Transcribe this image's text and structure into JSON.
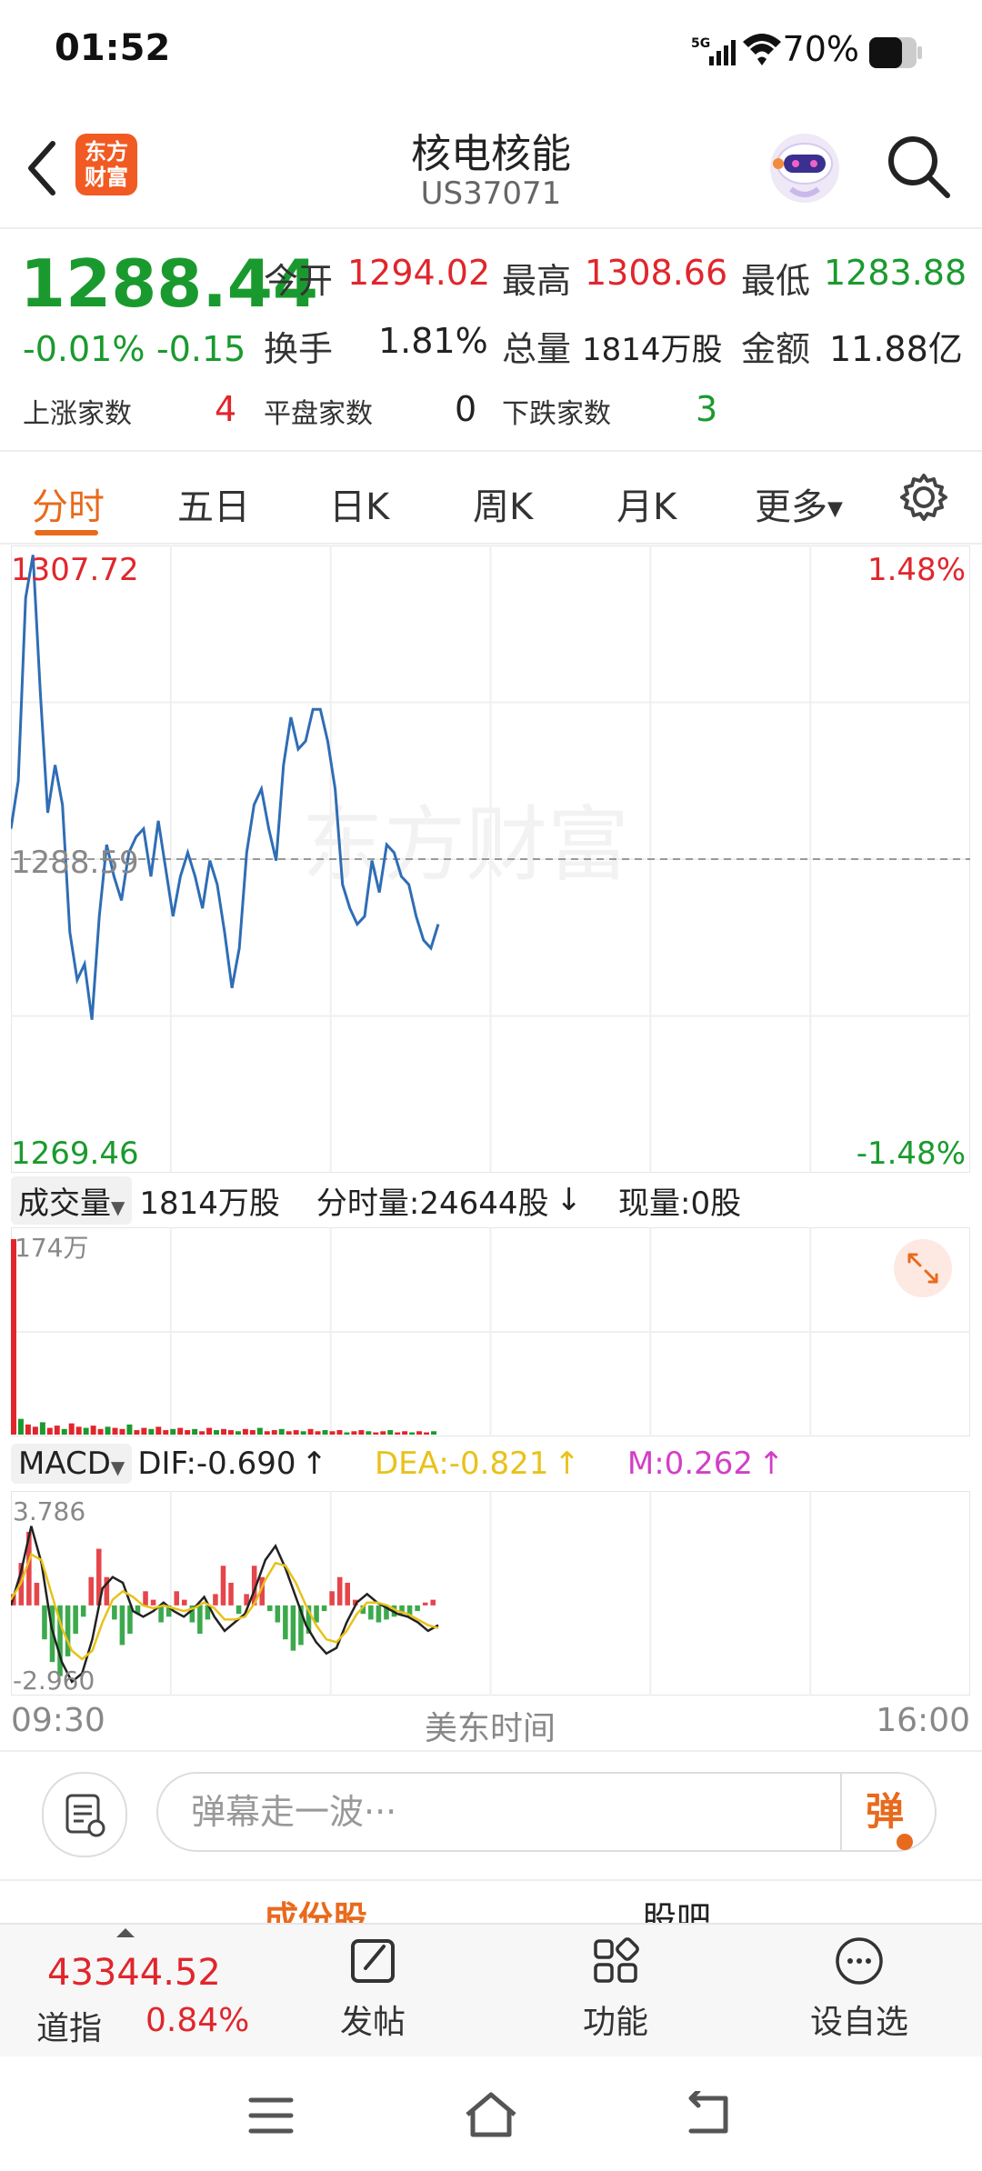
{
  "status_bar": {
    "time": "01:52",
    "network": "5G",
    "battery": "70%"
  },
  "header": {
    "title": "核电核能",
    "code": "US37071",
    "logo_text_1": "东方",
    "logo_text_2": "财富"
  },
  "quote": {
    "price": "1288.44",
    "change_pct": "-0.01%",
    "change_val": "-0.15",
    "open_label": "今开",
    "open": "1294.02",
    "high_label": "最高",
    "high": "1308.66",
    "low_label": "最低",
    "low": "1283.88",
    "turnover_label": "换手",
    "turnover": "1.81%",
    "volume_label": "总量",
    "volume": "1814万股",
    "amount_label": "金额",
    "amount": "11.88亿",
    "up_label": "上涨家数",
    "up": "4",
    "flat_label": "平盘家数",
    "flat": "0",
    "down_label": "下跌家数",
    "down": "3"
  },
  "tabs": {
    "t1": "分时",
    "t2": "五日",
    "t3": "日K",
    "t4": "周K",
    "t5": "月K",
    "t6": "更多"
  },
  "chart_data": [
    {
      "type": "line",
      "name": "intraday",
      "ymax_label": "1307.72",
      "ymin_label": "1269.46",
      "mid_label": "1288.59",
      "pct_max_label": "1.48%",
      "pct_min_label": "-1.48%",
      "ylim": [
        1269.46,
        1307.72
      ],
      "watermark": "东方财富",
      "values": [
        1290.5,
        1293.5,
        1305.0,
        1307.7,
        1299.0,
        1291.5,
        1294.5,
        1292.0,
        1284.0,
        1281.0,
        1282.0,
        1278.5,
        1285.0,
        1289.5,
        1287.5,
        1286.0,
        1289.0,
        1290.0,
        1290.5,
        1287.5,
        1291.0,
        1288.0,
        1285.0,
        1287.5,
        1289.0,
        1287.5,
        1285.5,
        1288.5,
        1287.0,
        1284.0,
        1280.5,
        1283.0,
        1289.0,
        1292.0,
        1293.0,
        1290.5,
        1288.5,
        1294.5,
        1297.5,
        1295.5,
        1296.0,
        1298.0,
        1298.0,
        1296.0,
        1293.0,
        1287.0,
        1285.5,
        1284.5,
        1285.0,
        1288.5,
        1286.5,
        1289.5,
        1289.0,
        1287.5,
        1287.0,
        1285.0,
        1283.5,
        1283.0,
        1284.5
      ]
    },
    {
      "type": "bar",
      "name": "volume",
      "max_label": "174万",
      "values": [
        174,
        14,
        9,
        7,
        11,
        6,
        8,
        5,
        10,
        7,
        6,
        8,
        5,
        7,
        6,
        5,
        9,
        4,
        6,
        5,
        7,
        4,
        5,
        6,
        4,
        5,
        3,
        6,
        4,
        5,
        4,
        3,
        5,
        4,
        6,
        3,
        4,
        5,
        3,
        4,
        3,
        5,
        3,
        4,
        3,
        4,
        2,
        3,
        4,
        3,
        2,
        3,
        4,
        2,
        3,
        2,
        3,
        2,
        3
      ]
    },
    {
      "type": "bar",
      "name": "MACD",
      "max_label": "3.786",
      "min_label": "-2.960",
      "ylim": [
        -2.96,
        3.786
      ],
      "hist": [
        0.4,
        1.5,
        2.6,
        0.8,
        -1.2,
        -2.0,
        -2.5,
        -1.8,
        -1.0,
        -0.4,
        1.0,
        2.0,
        1.0,
        -0.5,
        -1.4,
        -1.0,
        -0.3,
        0.5,
        0.2,
        -0.6,
        -0.4,
        0.5,
        0.2,
        -0.6,
        -1.0,
        -0.5,
        0.4,
        1.4,
        0.8,
        -0.3,
        0.4,
        1.4,
        1.0,
        -0.2,
        -0.6,
        -1.2,
        -1.6,
        -1.4,
        -1.0,
        -0.6,
        -0.2,
        0.5,
        1.0,
        0.8,
        0.2,
        -0.3,
        -0.5,
        -0.6,
        -0.5,
        -0.4,
        -0.3,
        -0.4,
        -0.2,
        0.1,
        0.2
      ],
      "dif": [
        0.0,
        1.2,
        2.8,
        1.5,
        -0.8,
        -2.0,
        -2.7,
        -2.4,
        -1.2,
        0.6,
        1.0,
        0.8,
        -0.2,
        -0.4,
        -0.2,
        0.1,
        -0.2,
        -0.4,
        -0.1,
        0.3,
        -0.4,
        -0.9,
        -0.6,
        -0.3,
        0.6,
        1.6,
        2.1,
        1.3,
        0.3,
        -0.7,
        -1.3,
        -1.7,
        -1.5,
        -0.6,
        0.1,
        0.4,
        0.1,
        -0.1,
        -0.3,
        -0.4,
        -0.6,
        -0.9,
        -0.7
      ],
      "dea": [
        0.2,
        0.8,
        1.8,
        1.6,
        0.4,
        -0.8,
        -1.6,
        -1.9,
        -1.6,
        -0.6,
        0.2,
        0.5,
        0.3,
        0.0,
        -0.1,
        0.0,
        -0.1,
        -0.2,
        -0.1,
        0.1,
        -0.1,
        -0.5,
        -0.5,
        -0.4,
        0.1,
        0.9,
        1.5,
        1.4,
        0.8,
        0.0,
        -0.7,
        -1.2,
        -1.3,
        -0.9,
        -0.3,
        0.1,
        0.1,
        0.0,
        -0.2,
        -0.3,
        -0.5,
        -0.7,
        -0.8
      ]
    }
  ],
  "volume_bar": {
    "selector": "成交量",
    "total": "1814万股",
    "tick_vol": "分时量:24644股",
    "tick_arrow": "↓",
    "cur_vol": "现量:0股"
  },
  "macd_bar": {
    "selector": "MACD",
    "dif": "DIF:-0.690",
    "dif_arrow": "↑",
    "dea": "DEA:-0.821",
    "dea_arrow": "↑",
    "m": "M:0.262",
    "m_arrow": "↑"
  },
  "time_axis": {
    "start": "09:30",
    "mid": "美东时间",
    "end": "16:00"
  },
  "danmaku": {
    "placeholder": "弹幕走一波···",
    "send": "弹"
  },
  "sub_tabs": {
    "left": "成份股",
    "right": "股吧"
  },
  "bottom_bar": {
    "index_value": "43344.52",
    "index_name": "道指",
    "index_pct": "0.84%",
    "post": "发帖",
    "func": "功能",
    "watch": "设自选"
  },
  "colors": {
    "up": "#e0262c",
    "down": "#1a9a2e",
    "accent": "#e86a1d",
    "line": "#2f6db5",
    "dea": "#e8c21a",
    "m": "#d23fc7"
  }
}
